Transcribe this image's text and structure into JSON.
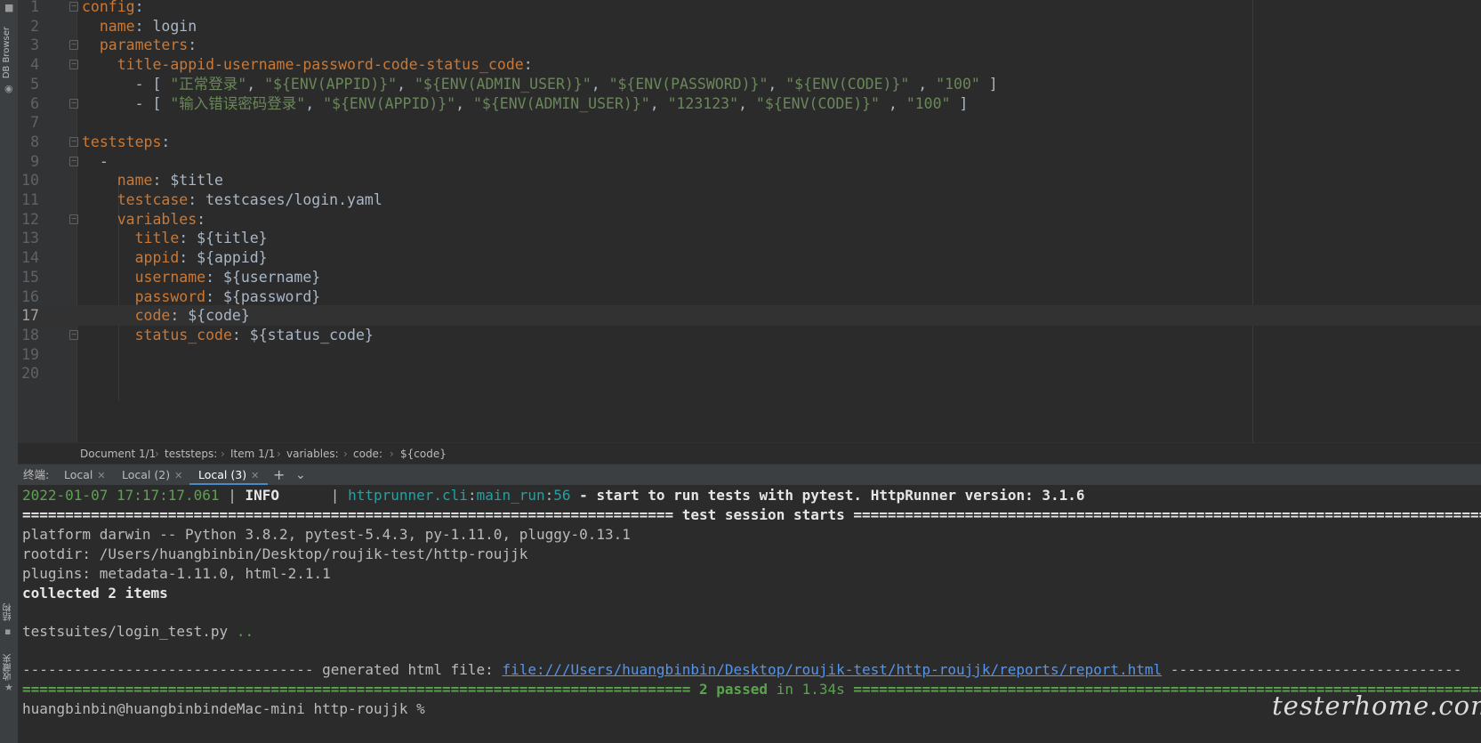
{
  "sidebar": {
    "db_browser_label": "DB Browser",
    "structure_label": "结构",
    "favorites_label": "收藏夹"
  },
  "editor": {
    "lines": [
      {
        "num": "1",
        "indent": "",
        "key": "config",
        "rest": ":"
      },
      {
        "num": "2",
        "indent": "  ",
        "key": "name",
        "rest": ": login"
      },
      {
        "num": "3",
        "indent": "  ",
        "key": "parameters",
        "rest": ":"
      },
      {
        "num": "4",
        "indent": "    ",
        "key": "title-appid-username-password-code-status_code",
        "rest": ":"
      },
      {
        "num": "5",
        "indent": "      ",
        "key": "",
        "rest": "- [ \"正常登录\", \"${ENV(APPID)}\", \"${ENV(ADMIN_USER)}\", \"${ENV(PASSWORD)}\", \"${ENV(CODE)}\" , \"100\" ]"
      },
      {
        "num": "6",
        "indent": "      ",
        "key": "",
        "rest": "- [ \"输入错误密码登录\", \"${ENV(APPID)}\", \"${ENV(ADMIN_USER)}\", \"123123\", \"${ENV(CODE)}\" , \"100\" ]"
      },
      {
        "num": "7",
        "indent": "",
        "key": "",
        "rest": ""
      },
      {
        "num": "8",
        "indent": "",
        "key": "teststeps",
        "rest": ":"
      },
      {
        "num": "9",
        "indent": "  ",
        "key": "",
        "rest": "-"
      },
      {
        "num": "10",
        "indent": "    ",
        "key": "name",
        "rest": ": $title"
      },
      {
        "num": "11",
        "indent": "    ",
        "key": "testcase",
        "rest": ": testcases/login.yaml"
      },
      {
        "num": "12",
        "indent": "    ",
        "key": "variables",
        "rest": ":"
      },
      {
        "num": "13",
        "indent": "      ",
        "key": "title",
        "rest": ": ${title}"
      },
      {
        "num": "14",
        "indent": "      ",
        "key": "appid",
        "rest": ": ${appid}"
      },
      {
        "num": "15",
        "indent": "      ",
        "key": "username",
        "rest": ": ${username}"
      },
      {
        "num": "16",
        "indent": "      ",
        "key": "password",
        "rest": ": ${password}"
      },
      {
        "num": "17",
        "indent": "      ",
        "key": "code",
        "rest": ": ${code}"
      },
      {
        "num": "18",
        "indent": "      ",
        "key": "status_code",
        "rest": ": ${status_code}"
      },
      {
        "num": "19",
        "indent": "",
        "key": "",
        "rest": ""
      },
      {
        "num": "20",
        "indent": "",
        "key": "",
        "rest": ""
      }
    ],
    "line5": {
      "dash": "- [ ",
      "s1": "\"正常登录\"",
      "s2": "\"${ENV(APPID)}\"",
      "s3": "\"${ENV(ADMIN_USER)}\"",
      "s4": "\"${ENV(PASSWORD)}\"",
      "s5": "\"${ENV(CODE)}\"",
      "s6": "\"100\"",
      "end": " ]"
    },
    "line6": {
      "dash": "- [ ",
      "s1": "\"输入错误密码登录\"",
      "s2": "\"${ENV(APPID)}\"",
      "s3": "\"${ENV(ADMIN_USER)}\"",
      "s4": "\"123123\"",
      "s5": "\"${ENV(CODE)}\"",
      "s6": "\"100\"",
      "end": " ]"
    }
  },
  "breadcrumb": [
    "Document 1/1",
    "teststeps:",
    "Item 1/1",
    "variables:",
    "code:",
    "${code}"
  ],
  "terminal_tabs": {
    "label": "终端:",
    "tabs": [
      "Local",
      "Local (2)",
      "Local (3)"
    ],
    "add": "+",
    "more": "⌄"
  },
  "terminal": {
    "log_time": "2022-01-07 17:17:17.061",
    "log_sep": " | ",
    "log_level": "INFO     ",
    "log_sep2": " | ",
    "log_module": "httprunner.cli",
    "log_colon": ":",
    "log_func": "main_run",
    "log_colon2": ":",
    "log_line": "56",
    "log_msg": " - start to run tests with pytest. HttpRunner version: 3.1.6",
    "session_line": "============================================================================ test session starts =============================================================================",
    "platform": "platform darwin -- Python 3.8.2, pytest-5.4.3, py-1.11.0, pluggy-0.13.1",
    "rootdir": "rootdir: /Users/huangbinbin/Desktop/roujik-test/http-roujjk",
    "plugins": "plugins: metadata-1.11.0, html-2.1.1",
    "collected": "collected 2 items",
    "suite_file": "testsuites/login_test.py ",
    "suite_dots": "..",
    "gen_prefix": "---------------------------------- generated html file: ",
    "gen_link": "file:///Users/huangbinbin/Desktop/roujik-test/http-roujjk/reports/report.html",
    "gen_suffix": " ----------------------------------",
    "passed_prefix": "============================================================================== ",
    "passed_count": "2 passed",
    "passed_time": " in 1.34s ",
    "passed_suffix": "==============================================================================",
    "prompt": "huangbinbin@huangbinbindeMac-mini http-roujjk % "
  },
  "watermark": "testerhome.com"
}
